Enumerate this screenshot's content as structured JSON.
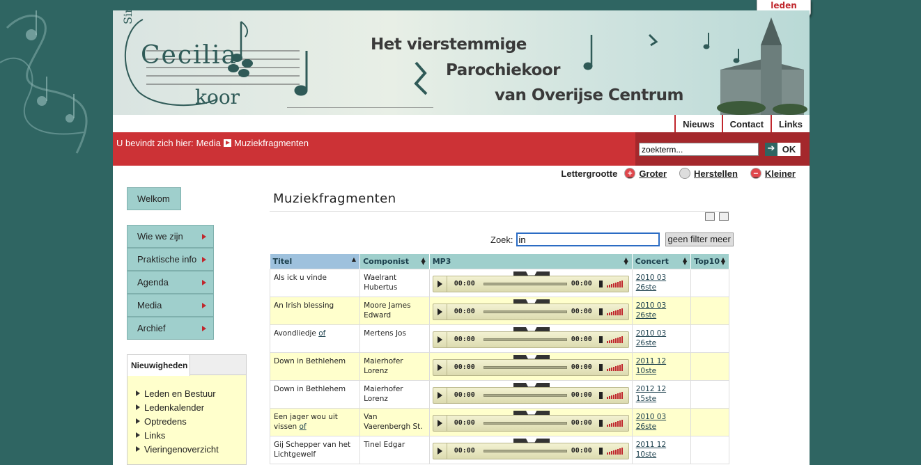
{
  "leden_tab": "leden",
  "banner": {
    "logo_sint": "Sint",
    "logo_cecilia": "Cecilia",
    "logo_koor": "koor",
    "title_line1": "Het vierstemmige",
    "title_line2": "Parochiekoor",
    "title_line3": "van Overijse Centrum"
  },
  "topnav": [
    "Nieuws",
    "Contact",
    "Links"
  ],
  "breadcrumb": {
    "prefix": "U bevindt zich hier:",
    "parent": "Media",
    "current": "Muziekfragmenten"
  },
  "search": {
    "placeholder": "zoekterm...",
    "ok": "OK"
  },
  "fontsize": {
    "label": "Lettergrootte",
    "bigger": "Groter",
    "reset": "Herstellen",
    "smaller": "Kleiner"
  },
  "sidebar": {
    "welkom": "Welkom",
    "items": [
      "Wie we zijn",
      "Praktische info",
      "Agenda",
      "Media",
      "Archief"
    ]
  },
  "news": {
    "tab": "Nieuwigheden",
    "items": [
      "Leden en Bestuur",
      "Ledenkalender",
      "Optredens",
      "Links",
      "Vieringenoverzicht"
    ]
  },
  "main": {
    "title": "Muziekfragmenten",
    "zoek_label": "Zoek:",
    "zoek_value": "in",
    "filter_button": "geen filter meer",
    "columns": [
      "Titel",
      "Componist",
      "MP3",
      "Concert",
      "Top10"
    ],
    "player_time": "00:00",
    "rows": [
      {
        "titel": "Als ick u vinde",
        "titel_link": "",
        "componist": "Waelrant Hubertus",
        "concert": "2010 03 26ste"
      },
      {
        "titel": "An Irish blessing",
        "titel_link": "",
        "componist": "Moore James Edward",
        "concert": "2010 03 26ste"
      },
      {
        "titel": "Avondliedje",
        "titel_link": "of",
        "componist": "Mertens Jos",
        "concert": "2010 03 26ste"
      },
      {
        "titel": "Down in Bethlehem",
        "titel_link": "",
        "componist": "Maierhofer Lorenz",
        "concert": "2011 12 10ste"
      },
      {
        "titel": "Down in Bethlehem",
        "titel_link": "",
        "componist": "Maierhofer Lorenz",
        "concert": "2012 12 15ste"
      },
      {
        "titel": "Een jager wou uit vissen",
        "titel_link": "of",
        "componist": "Van Vaerenbergh St.",
        "concert": "2010 03 26ste"
      },
      {
        "titel": "Gij Schepper van het Lichtgewelf",
        "titel_link": "",
        "componist": "Tinel Edgar",
        "concert": "2011 12 10ste"
      }
    ]
  }
}
